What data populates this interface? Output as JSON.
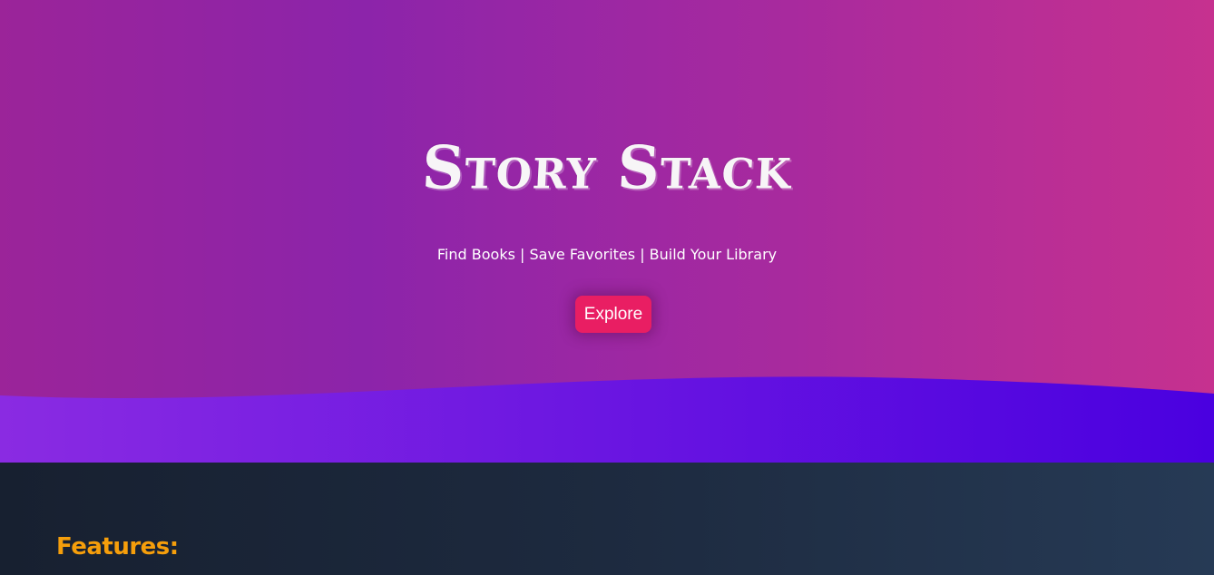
{
  "hero": {
    "title": "Story Stack",
    "tagline": "Find Books | Save Favorites | Build Your Library",
    "explore_label": "Explore"
  },
  "features": {
    "heading": "Features:"
  },
  "colors": {
    "hero_gradient_start": "#9b2499",
    "hero_gradient_end": "#c6318f",
    "wave_start": "#8a2be2",
    "wave_end": "#4a00e0",
    "button": "#e91e63",
    "features_heading": "#f59e0b",
    "features_bg": "#1d2a3f"
  }
}
